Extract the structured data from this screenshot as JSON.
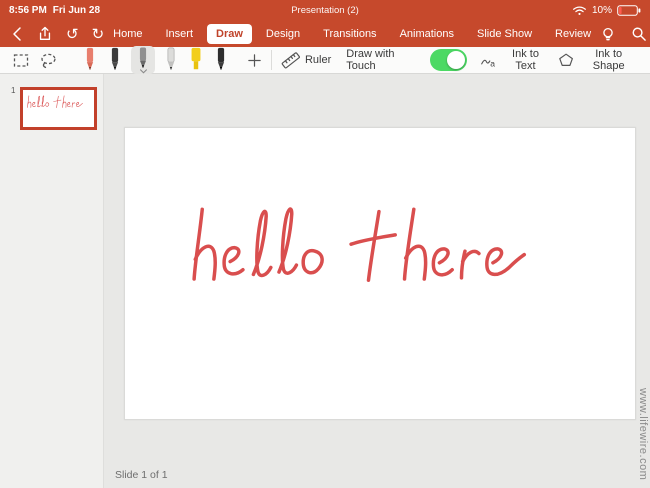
{
  "status_bar": {
    "time": "8:56 PM",
    "date": "Fri Jun 28",
    "battery_percent": "10%"
  },
  "title_bar": {
    "document_title": "Presentation (2)"
  },
  "tabs": [
    {
      "label": "Home",
      "active": false
    },
    {
      "label": "Insert",
      "active": false
    },
    {
      "label": "Draw",
      "active": true
    },
    {
      "label": "Design",
      "active": false
    },
    {
      "label": "Transitions",
      "active": false
    },
    {
      "label": "Animations",
      "active": false
    },
    {
      "label": "Slide Show",
      "active": false
    },
    {
      "label": "Review",
      "active": false
    }
  ],
  "icons": {
    "undo_glyph": "↺",
    "redo_glyph": "↻",
    "ink_to_text_glyph": "a"
  },
  "toolbar": {
    "ruler_label": "Ruler",
    "draw_with_touch_label": "Draw with Touch",
    "draw_with_touch_on": true,
    "ink_to_text_label": "Ink to Text",
    "ink_to_shape_label": "Ink to Shape",
    "pens": [
      "pencil-red",
      "pen-black",
      "pen-gray-selected",
      "pen-light",
      "highlighter-yellow",
      "pen-dark"
    ],
    "selected_pen_index": 2
  },
  "slides_panel": {
    "slide_number": "1",
    "thumbnail_ink_text": "hello there"
  },
  "canvas": {
    "ink_text": "hello there",
    "slide_status": "Slide 1 of 1"
  },
  "watermark": "www.lifewire.com",
  "colors": {
    "accent": "#C6492C",
    "active_tab_text": "#C0432A",
    "toggle_on": "#4CD964",
    "ink": "#D94E4E"
  }
}
